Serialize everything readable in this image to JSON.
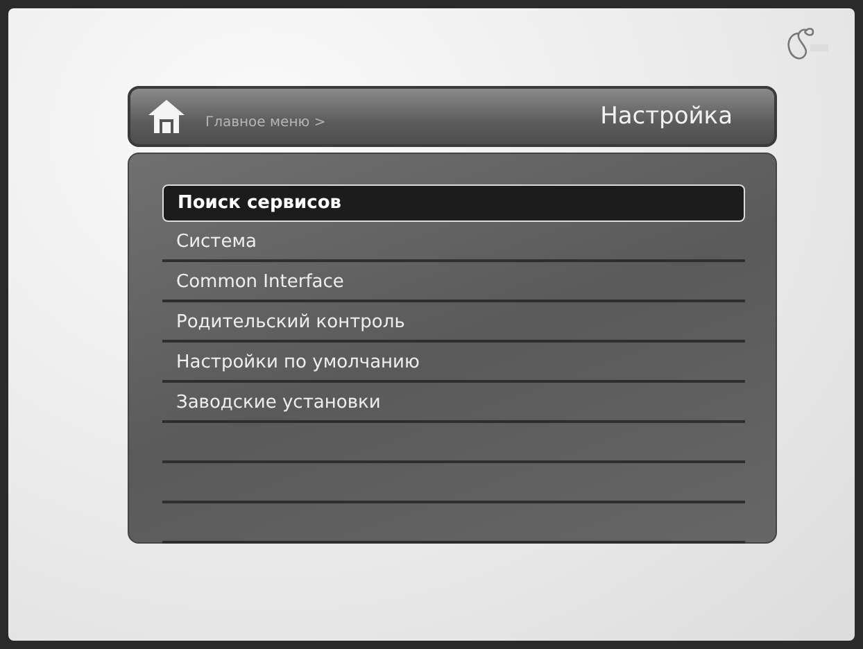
{
  "header": {
    "breadcrumb": "Главное меню >",
    "title": "Настройка"
  },
  "menu": {
    "items": [
      {
        "label": "Поиск сервисов",
        "selected": true
      },
      {
        "label": "Система",
        "selected": false
      },
      {
        "label": "Common Interface",
        "selected": false
      },
      {
        "label": "Родительский контроль",
        "selected": false
      },
      {
        "label": "Настройки по умолчанию",
        "selected": false
      },
      {
        "label": "Заводские установки",
        "selected": false
      }
    ]
  }
}
